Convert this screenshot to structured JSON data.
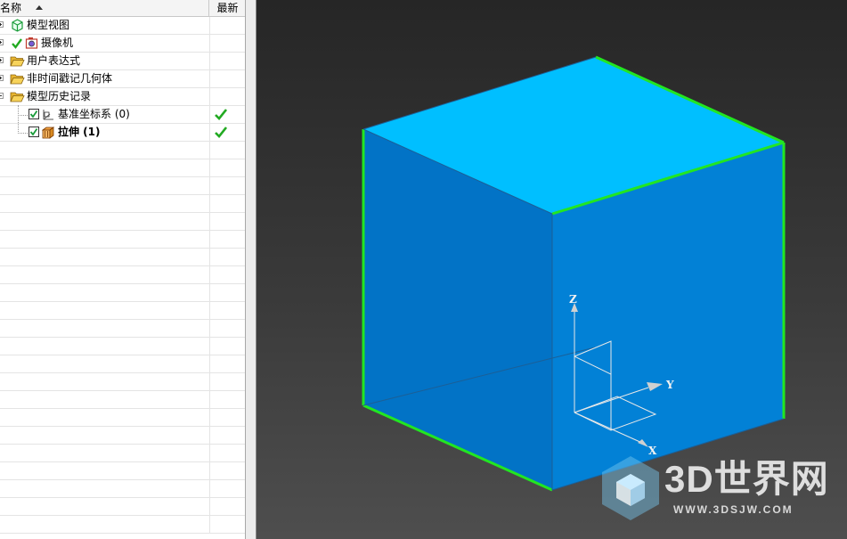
{
  "navigator": {
    "columns": {
      "name": "名称",
      "latest": "最新"
    },
    "items": [
      {
        "label": "模型视图",
        "icon": "model-view-icon",
        "expander": "plus"
      },
      {
        "label": "摄像机",
        "icon": "camera-icon",
        "expander": "plus",
        "checked_mark": true
      },
      {
        "label": "用户表达式",
        "icon": "folder-open-icon",
        "expander": "plus"
      },
      {
        "label": "非时间戳记几何体",
        "icon": "folder-open-icon",
        "expander": "plus"
      },
      {
        "label": "模型历史记录",
        "icon": "folder-open-icon",
        "expander": "minus"
      },
      {
        "label": "基准坐标系 (0)",
        "icon": "datum-csys-icon",
        "checkbox": true,
        "latest": "check-icon"
      },
      {
        "label": "拉伸 (1)",
        "icon": "extrude-icon",
        "checkbox": true,
        "bold": true,
        "latest": "check-icon"
      }
    ]
  },
  "viewport": {
    "triad": {
      "x_label": "X",
      "y_label": "Y",
      "z_label": "Z"
    },
    "colors": {
      "background_top": "#262626",
      "background_bottom": "#4e4e4e",
      "top_face": "#00bfff",
      "front_face": "#0281d6",
      "inner_face": "#0273c6",
      "floor_face": "#049ad8",
      "edge_highlight": "#22e622"
    }
  },
  "watermark": {
    "brand": "3D世界网",
    "url": "WWW.3DSJW.COM"
  }
}
